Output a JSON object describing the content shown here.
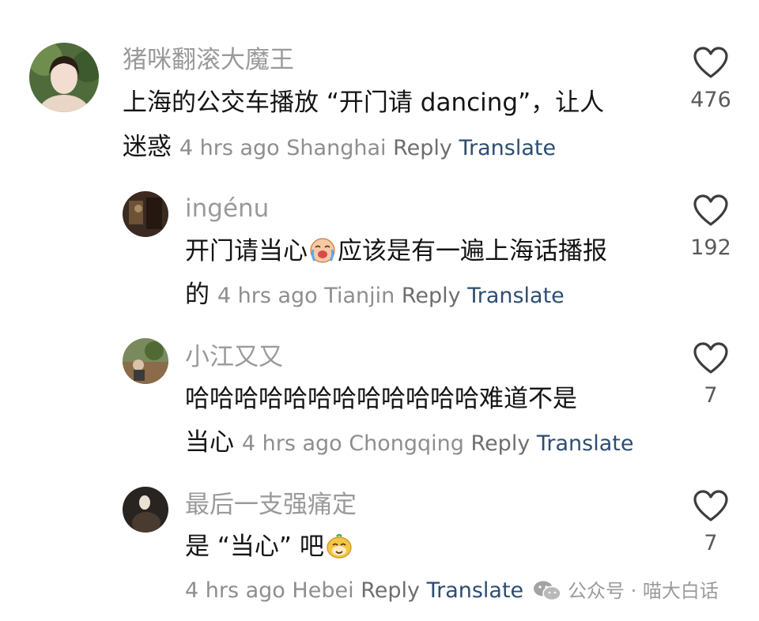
{
  "comments": [
    {
      "username": "猪咪翻滚大魔王",
      "text_line1": "上海的公交车播放 “开门请 dancing”，让人",
      "text_line2": "迷惑",
      "time": "4 hrs ago",
      "location": "Shanghai",
      "reply_label": "Reply",
      "translate_label": "Translate",
      "likes": "476"
    },
    {
      "username": "ingénu",
      "text_part1": "开门请当心",
      "emoji": "crying-laughing-face-emoji",
      "text_part2": "应该是有一遍上海话播报",
      "text_line2": "的",
      "time": "4 hrs ago",
      "location": "Tianjin",
      "reply_label": "Reply",
      "translate_label": "Translate",
      "likes": "192"
    },
    {
      "username": "小江又又",
      "text_line1": "哈哈哈哈哈哈哈哈哈哈哈哈难道不是",
      "text_line2": "当心",
      "time": "4 hrs ago",
      "location": "Chongqing",
      "reply_label": "Reply",
      "translate_label": "Translate",
      "likes": "7"
    },
    {
      "username": "最后一支强痛定",
      "text_part1": "是 “当心” 吧",
      "emoji": "sly-smile-face-emoji",
      "time": "4 hrs ago",
      "location": "Hebei",
      "reply_label": "Reply",
      "translate_label": "Translate",
      "likes": "7"
    }
  ],
  "watermark": {
    "text": "公众号 · 喵大白话",
    "icon": "wechat-logo-icon"
  },
  "colors": {
    "username": "#9a9a9a",
    "meta": "#8e8e8e",
    "translate": "#2d4d71",
    "text": "#141414"
  }
}
